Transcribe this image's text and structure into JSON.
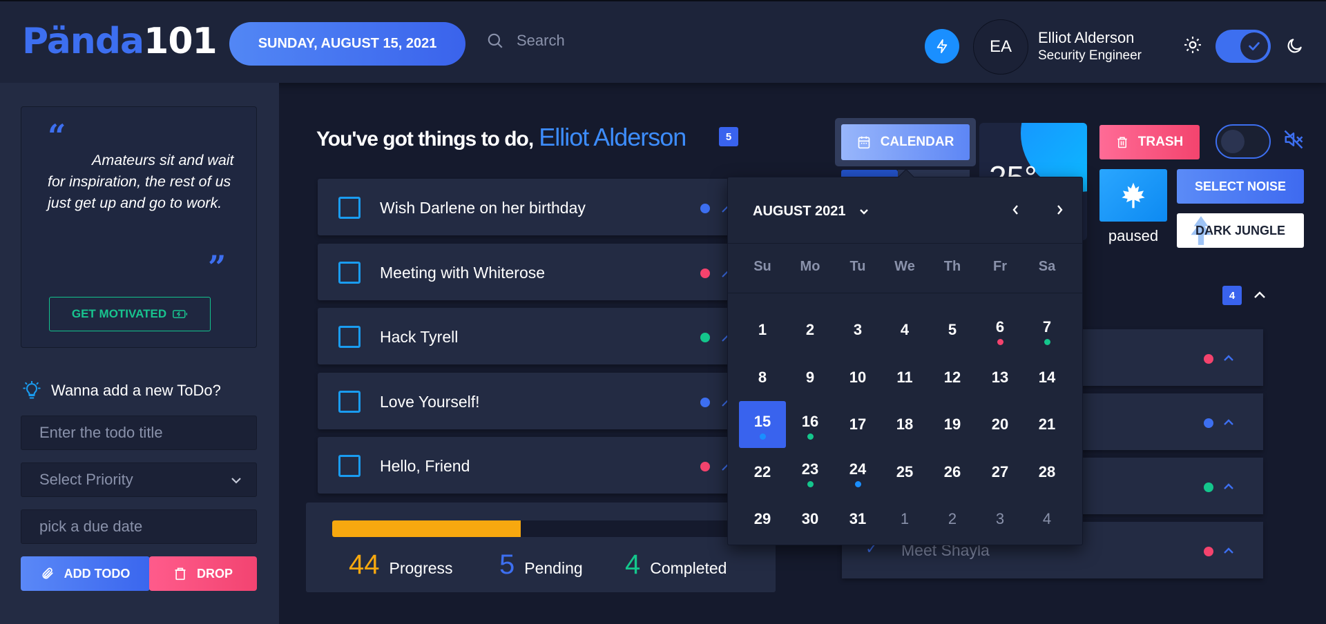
{
  "app": {
    "logo_accent": "Pända",
    "logo_rest": "101"
  },
  "header": {
    "date": "SUNDAY, AUGUST 15, 2021",
    "search_placeholder": "Search",
    "user": {
      "initials": "EA",
      "name": "Elliot Alderson",
      "role": "Security Engineer"
    },
    "theme_dark": true
  },
  "quote": {
    "text": "Amateurs sit and wait for inspiration, the rest of us just get up and go to work.",
    "button": "GET MOTIVATED"
  },
  "new_todo": {
    "label": "Wanna add a new ToDo?",
    "title_placeholder": "Enter the todo title",
    "priority_placeholder": "Select Priority",
    "date_placeholder": "pick a due date",
    "add_label": "ADD TODO",
    "drop_label": "DROP"
  },
  "main": {
    "greeting": "You've got things to do,",
    "greeting_name": "Elliot Alderson",
    "pending_badge": "5",
    "todos": [
      {
        "title": "Wish Darlene on her birthday",
        "priority_color": "#3d6ff0"
      },
      {
        "title": "Meeting with Whiterose",
        "priority_color": "#f4436d"
      },
      {
        "title": "Hack Tyrell",
        "priority_color": "#14c68c"
      },
      {
        "title": "Love Yourself!",
        "priority_color": "#3d6ff0"
      },
      {
        "title": "Hello, Friend",
        "priority_color": "#f4436d"
      }
    ],
    "stats": {
      "progress": "44",
      "progress_label": "Progress",
      "pending": "5",
      "pending_label": "Pending",
      "completed": "4",
      "completed_label": "Completed",
      "progress_fraction": 0.44
    }
  },
  "toolbar": {
    "calendar_label": "CALENDAR",
    "temperature": "25°",
    "trash_label": "TRASH",
    "select_noise_label": "SELECT NOISE",
    "noise_name": "DARK JUNGLE",
    "noise_status": "paused"
  },
  "completed_panel": {
    "badge": "4",
    "items": [
      {
        "title": "",
        "priority_color": "#f4436d"
      },
      {
        "title": "",
        "priority_color": "#3d6ff0"
      },
      {
        "title": "",
        "priority_color": "#14c68c"
      },
      {
        "title": "Meet Shayla",
        "priority_color": "#f4436d"
      }
    ]
  },
  "calendar": {
    "month_label": "AUGUST 2021",
    "weekdays": [
      "Su",
      "Mo",
      "Tu",
      "We",
      "Th",
      "Fr",
      "Sa"
    ],
    "weeks": [
      [
        {
          "d": "1"
        },
        {
          "d": "2"
        },
        {
          "d": "3"
        },
        {
          "d": "4"
        },
        {
          "d": "5"
        },
        {
          "d": "6",
          "ev": "#f4436d"
        },
        {
          "d": "7",
          "ev": "#14c68c"
        }
      ],
      [
        {
          "d": "8"
        },
        {
          "d": "9"
        },
        {
          "d": "10"
        },
        {
          "d": "11"
        },
        {
          "d": "12"
        },
        {
          "d": "13"
        },
        {
          "d": "14"
        }
      ],
      [
        {
          "d": "15",
          "sel": true,
          "ev": "#1a8fff"
        },
        {
          "d": "16",
          "ev": "#14c68c"
        },
        {
          "d": "17"
        },
        {
          "d": "18"
        },
        {
          "d": "19"
        },
        {
          "d": "20"
        },
        {
          "d": "21"
        }
      ],
      [
        {
          "d": "22"
        },
        {
          "d": "23",
          "ev": "#14c68c"
        },
        {
          "d": "24",
          "ev": "#1a8fff"
        },
        {
          "d": "25"
        },
        {
          "d": "26"
        },
        {
          "d": "27"
        },
        {
          "d": "28"
        }
      ],
      [
        {
          "d": "29"
        },
        {
          "d": "30"
        },
        {
          "d": "31"
        },
        {
          "d": "1",
          "dim": true
        },
        {
          "d": "2",
          "dim": true
        },
        {
          "d": "3",
          "dim": true
        },
        {
          "d": "4",
          "dim": true
        }
      ]
    ]
  },
  "colors": {
    "accent": "#3d6ff0",
    "progress": "#f7a80f",
    "completed": "#14c68c",
    "danger": "#f4436d"
  }
}
